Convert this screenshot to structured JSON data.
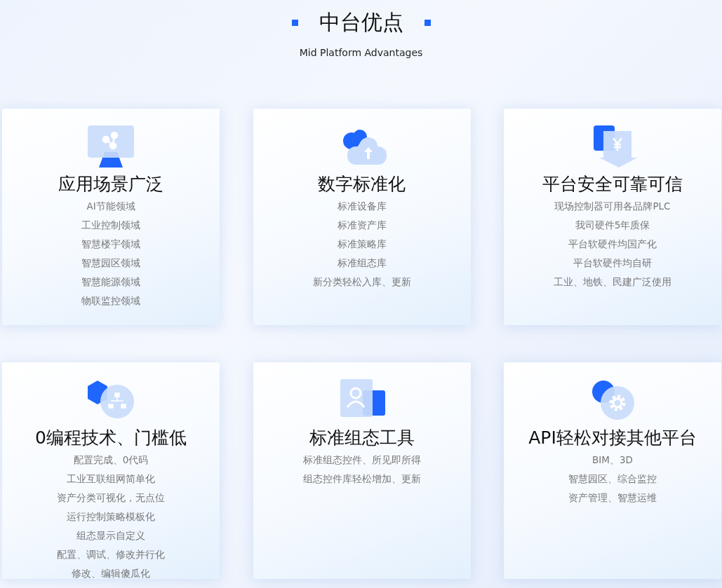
{
  "header": {
    "title": "中台优点",
    "subtitle": "Mid Platform Advantages"
  },
  "cards": [
    {
      "kind": "network",
      "title": "应用场景广泛",
      "items": [
        "AI节能领域",
        "工业控制领域",
        "智慧楼宇领域",
        "智慧园区领域",
        "智慧能源领域",
        "物联监控领域"
      ]
    },
    {
      "kind": "cloud",
      "title": "数字标准化",
      "items": [
        "标准设备库",
        "标准资产库",
        "标准策略库",
        "标准组态库",
        "新分类轻松入库、更新"
      ]
    },
    {
      "kind": "yen",
      "title": "平台安全可靠可信",
      "items": [
        "现场控制器可用各品牌PLC",
        "我司硬件5年质保",
        "平台软硬件均国产化",
        "平台软硬件均自研",
        "工业、地铁、民建广泛使用"
      ]
    },
    {
      "kind": "hierarchy",
      "title": "0编程技术、门槛低",
      "items": [
        "配置完成、0代码",
        "工业互联组网简单化",
        "资产分类可视化，无点位",
        "运行控制策略模板化",
        "组态显示自定义",
        "配置、调试、修改并行化",
        "修改、编辑傻瓜化"
      ]
    },
    {
      "kind": "user",
      "title": "标准组态工具",
      "items": [
        "标准组态控件、所见即所得",
        "组态控件库轻松增加、更新"
      ]
    },
    {
      "kind": "gear",
      "title": "API轻松对接其他平台",
      "items": [
        "BIM、3D",
        "智慧园区、综合监控",
        "资产管理、智慧运维"
      ]
    }
  ]
}
